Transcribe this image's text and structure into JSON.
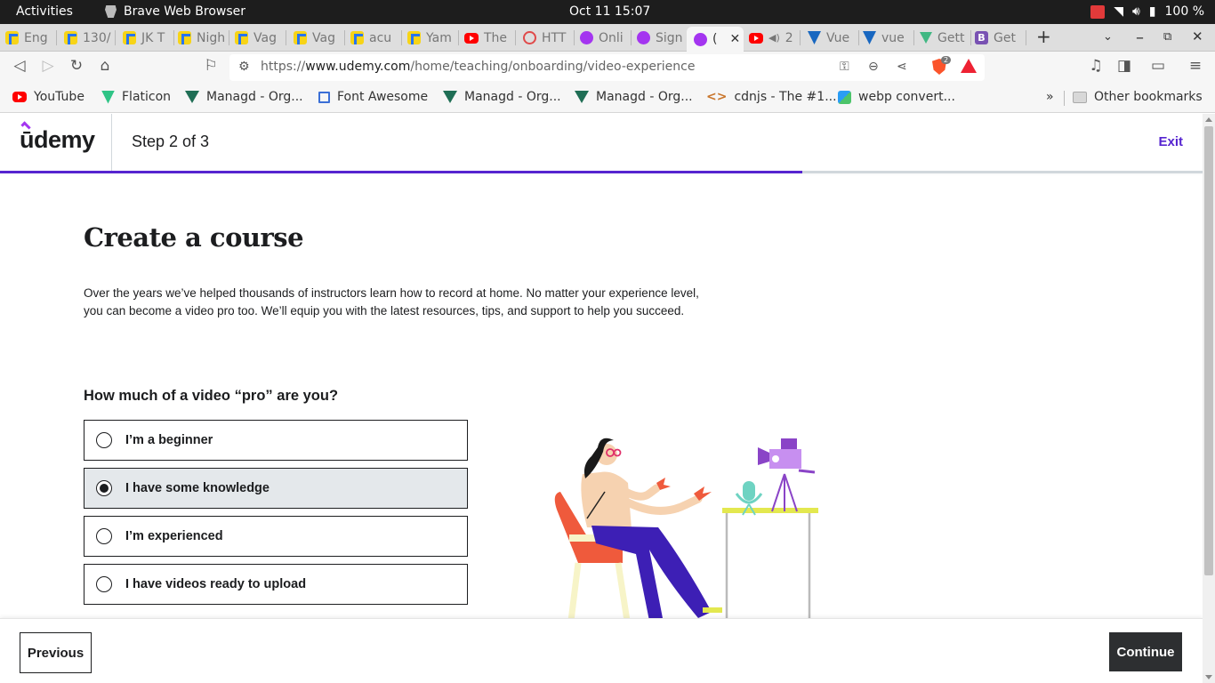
{
  "system": {
    "activities": "Activities",
    "app_name": "Brave Web Browser",
    "clock": "Oct 11  15:07",
    "battery": "100 %"
  },
  "tabs": [
    {
      "label": "Eng",
      "icon": "flipkart-icon"
    },
    {
      "label": "130/",
      "icon": "flipkart-icon"
    },
    {
      "label": "JK T",
      "icon": "flipkart-icon"
    },
    {
      "label": "Nigh",
      "icon": "flipkart-icon"
    },
    {
      "label": "Vag",
      "icon": "flipkart-icon"
    },
    {
      "label": "Vag",
      "icon": "flipkart-icon"
    },
    {
      "label": "acu",
      "icon": "flipkart-icon"
    },
    {
      "label": "Yam",
      "icon": "flipkart-icon"
    },
    {
      "label": "The",
      "icon": "youtube-icon"
    },
    {
      "label": "HTT",
      "icon": "http-icon"
    },
    {
      "label": "Onli",
      "icon": "udemy-icon"
    },
    {
      "label": "Sign",
      "icon": "udemy-icon"
    },
    {
      "label": "(",
      "icon": "udemy-icon",
      "active": true
    },
    {
      "label": "2",
      "icon": "youtube-icon"
    },
    {
      "label": "Vue",
      "icon": "vuetify-icon"
    },
    {
      "label": "vue",
      "icon": "vuetify-icon"
    },
    {
      "label": "Gett",
      "icon": "vue-icon"
    },
    {
      "label": "Get",
      "icon": "bootstrap-icon"
    }
  ],
  "address_bar": {
    "url_prefix": "https://",
    "url_host": "www.udemy.com",
    "url_path": "/home/teaching/onboarding/video-experience",
    "shield_count": "2"
  },
  "bookmarks": [
    {
      "label": "YouTube",
      "icon": "youtube-icon"
    },
    {
      "label": "Flaticon",
      "icon": "flaticon-icon"
    },
    {
      "label": "Managd - Org...",
      "icon": "managd-icon"
    },
    {
      "label": "Font Awesome",
      "icon": "flag-icon"
    },
    {
      "label": "Managd - Org...",
      "icon": "managd-icon"
    },
    {
      "label": "Managd - Org...",
      "icon": "managd-icon"
    },
    {
      "label": "cdnjs - The #1...",
      "icon": "code-icon"
    },
    {
      "label": "webp convert...",
      "icon": "webp-icon"
    }
  ],
  "bookmarks_more": "»",
  "other_bookmarks": "Other bookmarks",
  "udemy": {
    "logo": "ūdemy",
    "step": "Step 2 of 3",
    "exit": "Exit",
    "progress_fraction": 0.667,
    "accent_color": "#5624d0",
    "title": "Create a course",
    "description": "Over the years we’ve helped thousands of instructors learn how to record at home. No matter your experience level, you can become a video pro too. We’ll equip you with the latest resources, tips, and support to help you succeed.",
    "question": "How much of a video “pro” are you?",
    "options": [
      {
        "label": "I’m a beginner",
        "selected": false
      },
      {
        "label": "I have some knowledge",
        "selected": true
      },
      {
        "label": "I’m experienced",
        "selected": false
      },
      {
        "label": "I have videos ready to upload",
        "selected": false
      }
    ],
    "previous": "Previous",
    "continue": "Continue"
  }
}
